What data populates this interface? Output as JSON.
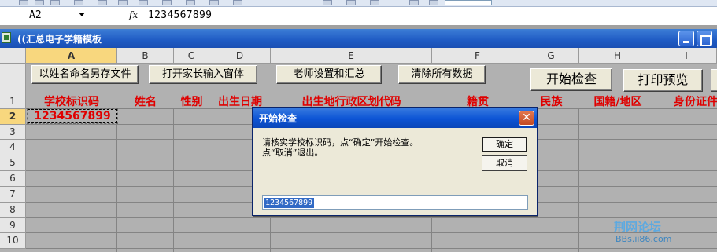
{
  "formula_bar": {
    "name_box": "A2",
    "fx_label": "fx",
    "value": "1234567899"
  },
  "workbook": {
    "title": "((汇总电子学籍模板"
  },
  "columns": [
    "A",
    "B",
    "C",
    "D",
    "E",
    "F",
    "G",
    "H",
    "I"
  ],
  "rows": [
    "1",
    "2",
    "3",
    "4",
    "5",
    "6",
    "7",
    "8",
    "9",
    "10"
  ],
  "sheet_buttons": {
    "save_as": "以姓名命名另存文件",
    "open_parent": "打开家长输入窗体",
    "teacher_settings": "老师设置和汇总",
    "clear_all": "清除所有数据",
    "start_check": "开始检查",
    "print_preview": "打印预览"
  },
  "header_row": {
    "a": "学校标识码",
    "b": "姓名",
    "c": "性别",
    "d": "出生日期",
    "e": "出生地行政区划代码",
    "f": "籍贯",
    "g": "民族",
    "h": "国籍/地区",
    "i": "身份证件"
  },
  "cell_a2": "1234567899",
  "dialog": {
    "title": "开始检查",
    "message_line1": "请核实学校标识码，点“确定”开始检查。",
    "message_line2": "点“取消”退出。",
    "ok_label": "确定",
    "cancel_label": "取消",
    "input_value": "1234567899"
  },
  "watermark": {
    "text": "荆网论坛",
    "url": "BBs.ii86.com"
  }
}
